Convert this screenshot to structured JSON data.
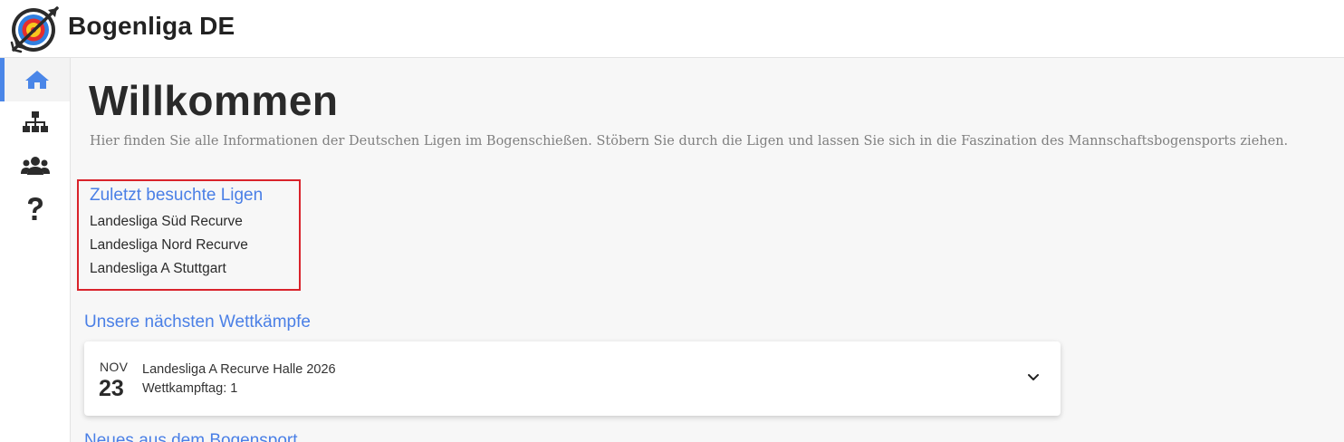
{
  "header": {
    "app_title": "Bogenliga DE",
    "logo_icon": "archery-target-logo"
  },
  "sidebar": {
    "items": [
      {
        "icon": "home-icon",
        "active": true
      },
      {
        "icon": "sitemap-icon",
        "active": false
      },
      {
        "icon": "users-icon",
        "active": false
      },
      {
        "icon": "question-icon",
        "active": false
      }
    ],
    "accent_color": "#4a86e8"
  },
  "main": {
    "title": "Willkommen",
    "intro": "Hier finden Sie alle Informationen der Deutschen Ligen im Bogenschießen. Stöbern Sie durch die Ligen und lassen Sie sich in die Faszination des Mannschaftsbogensports ziehen.",
    "recent": {
      "title": "Zuletzt besuchte Ligen",
      "items": [
        "Landesliga Süd Recurve",
        "Landesliga Nord Recurve",
        "Landesliga A Stuttgart"
      ],
      "highlight_color": "#d9232b"
    },
    "upcoming": {
      "title": "Unsere nächsten Wettkämpfe",
      "events": [
        {
          "month": "NOV",
          "day": "23",
          "name": "Landesliga A Recurve Halle 2026",
          "subtitle": "Wettkampftag: 1"
        }
      ]
    },
    "news": {
      "title": "Neues aus dem Bogensport"
    }
  }
}
